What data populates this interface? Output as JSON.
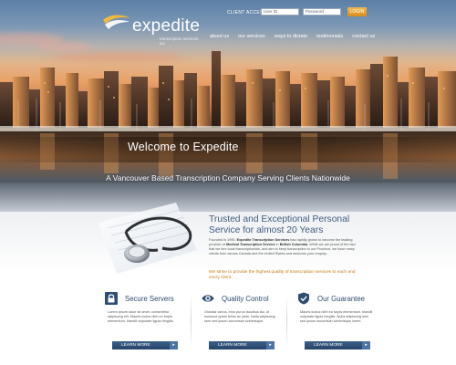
{
  "header": {
    "logo_text": "expedite",
    "logo_sub": "transcription services inc.",
    "client_access_label": "CLIENT ACCESS",
    "user_placeholder": "User ID",
    "password_placeholder": "Password",
    "login_label": "LOGIN",
    "nav": [
      {
        "label": "about us"
      },
      {
        "label": "our services"
      },
      {
        "label": "ways to dictate"
      },
      {
        "label": "testimonials"
      },
      {
        "label": "contact us"
      }
    ]
  },
  "hero": {
    "welcome": "Welcome to Expedite",
    "tagline": "A Vancouver Based Transcription Company Serving Clients Nationwide"
  },
  "intro": {
    "heading_line1": "Trusted and Exceptional Personal",
    "heading_line2": "Service for almost 20 Years",
    "text_1": "Founded in 1995, ",
    "text_bold_1": "Expedite Transcription Services",
    "text_2": " has rapidly grown to become the leading provider of ",
    "text_bold_2": "Medical Transcription Service",
    "text_3": " in ",
    "text_bold_3": "British Columbia",
    "text_4": ". While we are proud of the fact that we hire local transcriptionists, and aim to keep transcription in our Province, we have many clients from across Canada and the United States and welcome your enquiry.",
    "strive": "We strive to provide the highest quality of transcription services to each and every client."
  },
  "features": [
    {
      "icon": "lock-icon",
      "title": "Secure Servers",
      "body": "Lorem ipsum dolor sit amet, consectetur adipiscing elit. Mauris luctus nibh eu turpis elementum, blandit vulputate ligula fringilla.",
      "button": "LEARN MORE"
    },
    {
      "icon": "eye-icon",
      "title": "Quality Control",
      "body": "Gravida varius, eros purus faucibus dui, ut euismod quam tellus ac justo. Nulla adipiscing sem sed ipsum accumsan scelerisque.",
      "button": "LEARN MORE"
    },
    {
      "icon": "shield-check-icon",
      "title": "Our Guarantee",
      "body": "Mauris luctus nibh eu turpis elementum, blandit vulputate ligula fringilla. Nulla adipiscing sem sed ipsum accumsan scelerisque lorem.",
      "button": "LEARN MORE"
    }
  ],
  "colors": {
    "accent_orange": "#d98e1c",
    "heading_blue": "#3f5d7f",
    "button_blue": "#24436a"
  }
}
